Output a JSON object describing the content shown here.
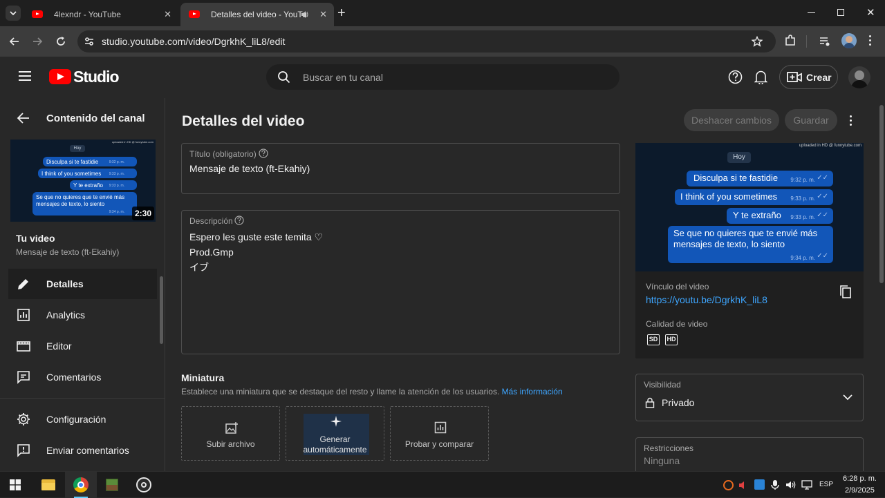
{
  "browser": {
    "tabs": [
      {
        "title": "4lexndr - YouTube"
      },
      {
        "title": "Detalles del video - YouTub"
      }
    ],
    "url": "studio.youtube.com/video/DgrkhK_liL8/edit"
  },
  "header": {
    "logo_text": "Studio",
    "search_placeholder": "Buscar en tu canal",
    "create_label": "Crear"
  },
  "sidebar": {
    "back_title": "Contenido del canal",
    "thumb_duration": "2:30",
    "your_video_label": "Tu video",
    "video_title": "Mensaje de texto (ft-Ekahiy)",
    "items": [
      {
        "label": "Detalles",
        "icon": "pencil-icon",
        "active": true
      },
      {
        "label": "Analytics",
        "icon": "analytics-icon"
      },
      {
        "label": "Editor",
        "icon": "film-icon"
      },
      {
        "label": "Comentarios",
        "icon": "comment-icon"
      }
    ],
    "bottom_items": [
      {
        "label": "Configuración",
        "icon": "gear-icon"
      },
      {
        "label": "Enviar comentarios",
        "icon": "feedback-icon"
      }
    ]
  },
  "main": {
    "page_title": "Detalles del video",
    "undo_label": "Deshacer cambios",
    "save_label": "Guardar",
    "title_field": {
      "label": "Título (obligatorio)",
      "value": "Mensaje de texto (ft-Ekahiy)"
    },
    "description_field": {
      "label": "Descripción",
      "lines": [
        "Espero les guste este temita ♡",
        "Prod.Gmp",
        "イブ"
      ]
    },
    "thumbnail": {
      "heading": "Miniatura",
      "subtitle": "Establece una miniatura que se destaque del resto y llame la atención de los usuarios.",
      "more_info": "Más información",
      "options": [
        {
          "label": "Subir archivo"
        },
        {
          "label_line1": "Generar",
          "label_line2": "automáticamente"
        },
        {
          "label": "Probar y comparar"
        }
      ]
    }
  },
  "chat": {
    "day_label": "Hoy",
    "watermark": "uploaded in HD @ funnytube.com",
    "messages": [
      {
        "text": "Disculpa si te fastidie",
        "time": "9:32 p. m."
      },
      {
        "text": "I think of you sometimes",
        "time": "9:33 p. m."
      },
      {
        "text": "Y te extraño",
        "time": "9:33 p. m."
      },
      {
        "text_line1": "Se que no quieres que te envié más",
        "text_line2": "mensajes de texto, lo siento",
        "time": "9:34 p. m."
      }
    ]
  },
  "right_panel": {
    "link_label": "Vínculo del video",
    "link_url": "https://youtu.be/DgrkhK_liL8",
    "quality_label": "Calidad de video",
    "quality_badges": [
      "SD",
      "HD"
    ],
    "visibility": {
      "label": "Visibilidad",
      "value": "Privado"
    },
    "restrictions": {
      "label": "Restricciones",
      "value": "Ninguna"
    }
  },
  "taskbar": {
    "language": "ESP",
    "time": "6:28 p. m.",
    "date": "2/9/2025"
  },
  "colors": {
    "youtube_red": "#ff0000",
    "link_blue": "#3ea6ff",
    "bubble_blue": "#1256b8"
  }
}
